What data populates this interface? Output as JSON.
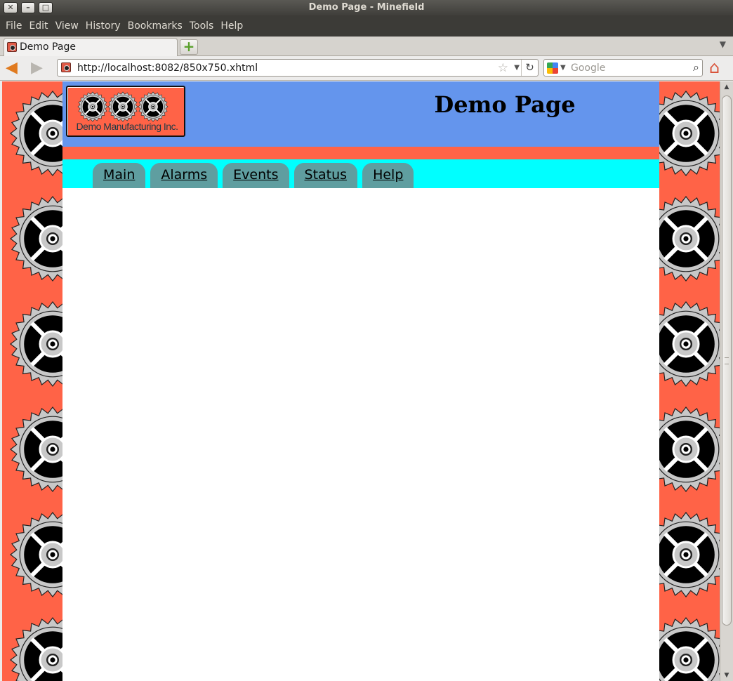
{
  "window": {
    "title": "Demo Page - Minefield"
  },
  "menubar": {
    "items": [
      {
        "label": "File"
      },
      {
        "label": "Edit"
      },
      {
        "label": "View"
      },
      {
        "label": "History"
      },
      {
        "label": "Bookmarks"
      },
      {
        "label": "Tools"
      },
      {
        "label": "Help"
      }
    ]
  },
  "tabs": {
    "active_label": "Demo Page",
    "new_tab_label": "+",
    "list_label": "▼"
  },
  "nav": {
    "url": "http://localhost:8082/850x750.xhtml",
    "search_placeholder": "Google"
  },
  "page": {
    "logo_text": "Demo Manufacturing Inc.",
    "title": "Demo Page",
    "nav_tabs": [
      {
        "label": "Main"
      },
      {
        "label": "Alarms"
      },
      {
        "label": "Events"
      },
      {
        "label": "Status"
      },
      {
        "label": "Help"
      }
    ]
  },
  "colors": {
    "background": "#ff6347",
    "header": "#6495ed",
    "nav_strip": "#00ffff",
    "nav_tab": "#5f9ea0"
  },
  "icons": [
    "close-icon",
    "minimize-icon",
    "maximize-icon",
    "back-arrow-icon",
    "forward-arrow-icon",
    "bookmark-star-icon",
    "reload-icon",
    "google-icon",
    "magnifier-icon",
    "home-icon",
    "gear-icon"
  ]
}
